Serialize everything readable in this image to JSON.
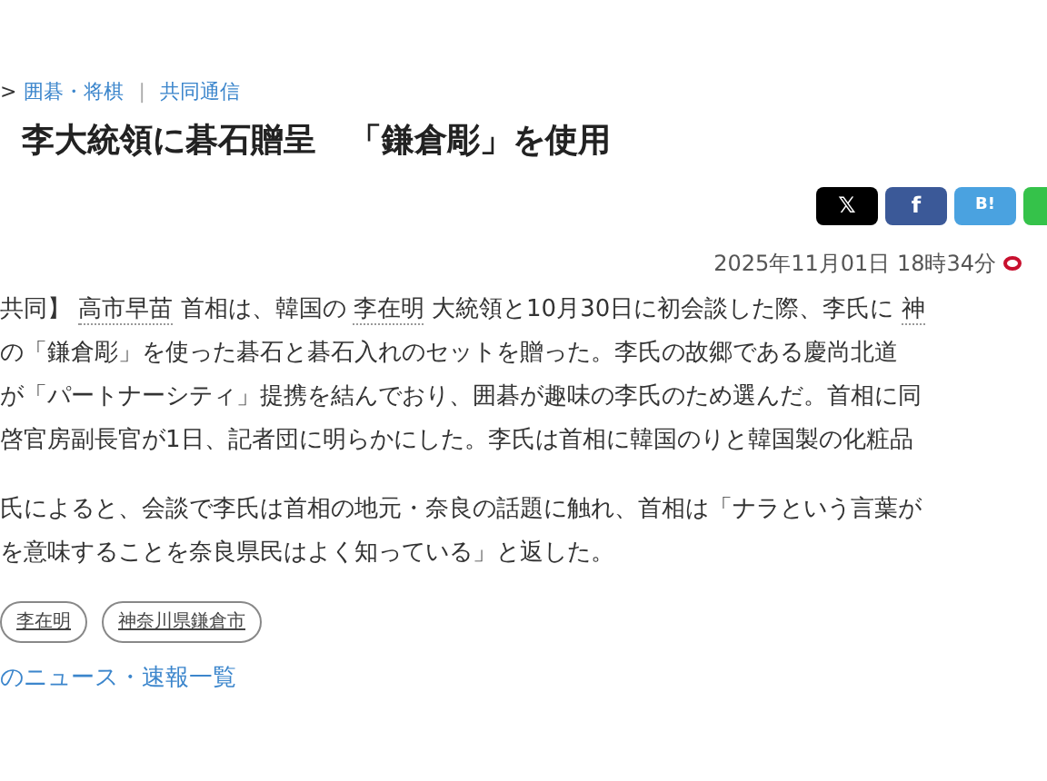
{
  "breadcrumb": {
    "prefix": ">",
    "items": [
      {
        "text": "囲碁・将棋"
      },
      {
        "text": "共同通信"
      }
    ],
    "separator": "|"
  },
  "title": "李大統領に碁石贈呈　「鎌倉彫」を使用",
  "share_buttons": [
    {
      "kind": "x",
      "label": "𝕏"
    },
    {
      "kind": "facebook",
      "label": "f"
    },
    {
      "kind": "hatena",
      "label": "B!"
    },
    {
      "kind": "line"
    }
  ],
  "date": "2025年11月01日 18時34分",
  "paragraphs": [
    {
      "lines": [
        [
          {
            "text": "共同】 "
          },
          {
            "text": "高市早苗",
            "link": true
          },
          {
            "text": " 首相は、韓国の "
          },
          {
            "text": "李在明",
            "link": true
          },
          {
            "text": " 大統領と10月30日に初会談した際、李氏に "
          },
          {
            "text": "神",
            "link": true
          }
        ],
        [
          {
            "text": "の「鎌倉彫」を使った碁石と碁石入れのセットを贈った。李氏の故郷である慶尚北道"
          }
        ],
        [
          {
            "text": "が「パートナーシティ」提携を結んでおり、囲碁が趣味の李氏のため選んだ。首相に同"
          }
        ],
        [
          {
            "text": "啓官房副長官が1日、記者団に明らかにした。李氏は首相に韓国のりと韓国製の化粧品"
          }
        ]
      ]
    },
    {
      "lines": [
        [
          {
            "text": "氏によると、会談で李氏は首相の地元・奈良の話題に触れ、首相は「ナラという言葉が"
          }
        ],
        [
          {
            "text": "を意味することを奈良県民はよく知っている」と返した。"
          }
        ]
      ]
    }
  ],
  "tags": [
    "李在明",
    "神奈川県鎌倉市"
  ],
  "list_link": "のニュース・速報一覧"
}
